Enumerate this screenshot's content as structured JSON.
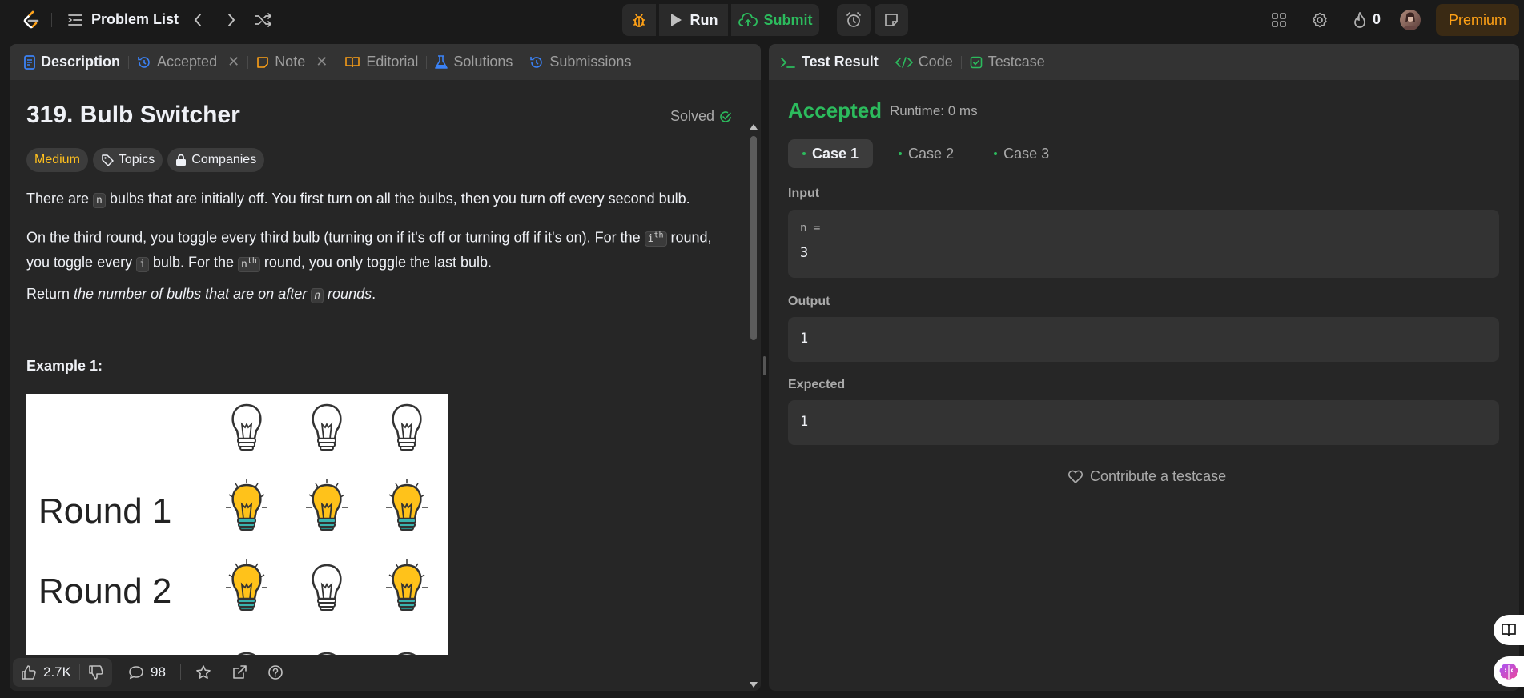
{
  "topbar": {
    "problem_list_label": "Problem List",
    "run_label": "Run",
    "submit_label": "Submit",
    "streak_count": "0",
    "premium_label": "Premium"
  },
  "left_tabs": [
    {
      "label": "Description",
      "icon": "document-icon"
    },
    {
      "label": "Accepted",
      "icon": "history-icon"
    },
    {
      "label": "Note",
      "icon": "note-icon"
    },
    {
      "label": "Editorial",
      "icon": "book-icon"
    },
    {
      "label": "Solutions",
      "icon": "flask-icon"
    },
    {
      "label": "Submissions",
      "icon": "history-icon"
    }
  ],
  "problem": {
    "title": "319. Bulb Switcher",
    "solved_label": "Solved",
    "difficulty": "Medium",
    "topics_label": "Topics",
    "companies_label": "Companies",
    "p1_a": "There are ",
    "p1_code": "n",
    "p1_b": " bulbs that are initially off. You first turn on all the bulbs, then you turn off every second bulb.",
    "p2_a": "On the third round, you toggle every third bulb (turning on if it's off or turning off if it's on). For the ",
    "p2_code1": "i",
    "p2_sup1": "th",
    "p2_b": " round,",
    "p2_c": "you toggle every ",
    "p2_code2": "i",
    "p2_d": " bulb. For the ",
    "p2_code3": "n",
    "p2_sup2": "th",
    "p2_e": " round, you only toggle the last bulb.",
    "p3_a": "Return ",
    "p3_em1": "the number of bulbs that are on after ",
    "p3_code": "n",
    "p3_em2": " rounds",
    "p3_end": ".",
    "example_title": "Example 1:",
    "example_rows": [
      {
        "label": "",
        "bulbs": [
          "off",
          "off",
          "off"
        ]
      },
      {
        "label": "Round 1",
        "bulbs": [
          "on",
          "on",
          "on"
        ]
      },
      {
        "label": "Round 2",
        "bulbs": [
          "on",
          "off",
          "on"
        ]
      }
    ]
  },
  "footer": {
    "likes": "2.7K",
    "comments": "98"
  },
  "right_tabs": [
    {
      "label": "Test Result",
      "icon": "terminal-icon"
    },
    {
      "label": "Code",
      "icon": "code-icon"
    },
    {
      "label": "Testcase",
      "icon": "checkbox-icon"
    }
  ],
  "result": {
    "status": "Accepted",
    "runtime": "Runtime: 0 ms",
    "cases": [
      "Case 1",
      "Case 2",
      "Case 3"
    ],
    "input_label": "Input",
    "input_var": "n =",
    "input_value": "3",
    "output_label": "Output",
    "output_value": "1",
    "expected_label": "Expected",
    "expected_value": "1",
    "contribute_label": "Contribute a testcase"
  },
  "colors": {
    "accent_green": "#2cbb5d",
    "medium_yellow": "#ffc01e",
    "premium_orange": "#ffa116"
  }
}
